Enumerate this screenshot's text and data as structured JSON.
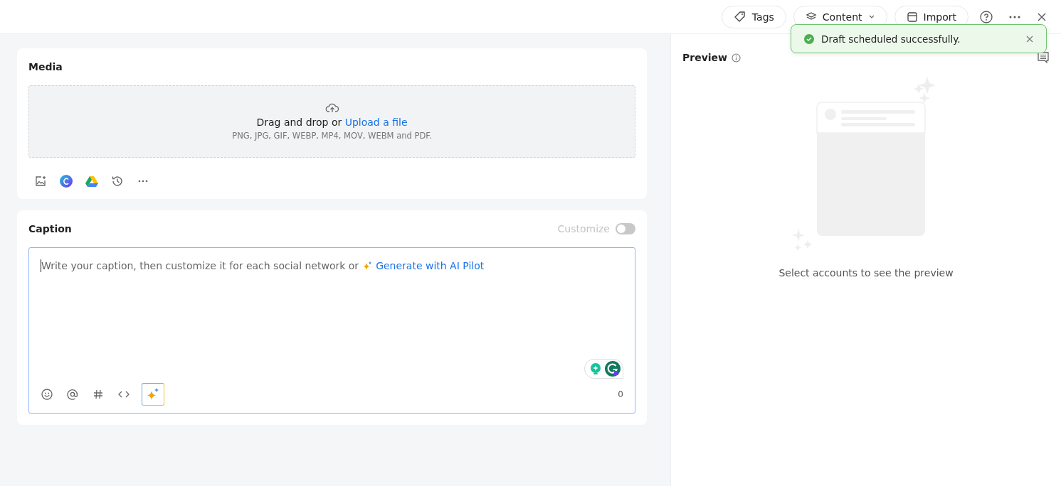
{
  "toolbar": {
    "buttons": [
      {
        "kind": "tags",
        "label": "Tags"
      },
      {
        "kind": "content",
        "label": "Content"
      },
      {
        "kind": "import",
        "label": "Import"
      }
    ]
  },
  "toast": {
    "message": "Draft scheduled successfully."
  },
  "media": {
    "title": "Media",
    "dropzone": {
      "text": "Drag and drop or",
      "link": "Upload a file",
      "formats": "PNG, JPG, GIF, WEBP, MP4, MOV, WEBM and PDF."
    }
  },
  "caption": {
    "title": "Caption",
    "customize": {
      "label": "Customize",
      "on": false,
      "disabled": true
    },
    "placeholder": "Write your caption, then customize it for each social network or",
    "ai_link": "Generate with AI Pilot",
    "count": "0"
  },
  "preview": {
    "title": "Preview",
    "empty_text": "Select accounts to see the preview"
  }
}
